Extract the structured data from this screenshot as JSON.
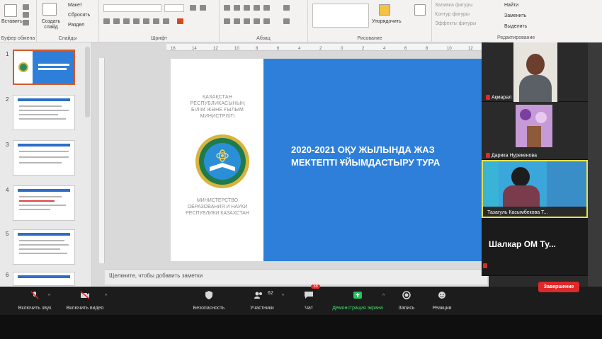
{
  "ribbon": {
    "groups": [
      "Буфер обмена",
      "Слайды",
      "Шрифт",
      "Абзац",
      "Рисование",
      "Редактирование"
    ],
    "clipboard_paste": "Вставить",
    "new_slide": "Создать слайд",
    "layout": "Макет",
    "reset": "Сбросить",
    "section": "Раздел",
    "arrange": "Упорядочить",
    "quick_styles": "Экспресс-стили",
    "shape_fill": "Заливка фигуры",
    "shape_outline": "Контур фигуры",
    "shape_effects": "Эффекты фигуры",
    "find": "Найти",
    "replace": "Заменить",
    "select": "Выделить"
  },
  "ruler": {
    "ticks": [
      "16",
      "14",
      "12",
      "10",
      "8",
      "6",
      "4",
      "2",
      "0",
      "2",
      "4",
      "6",
      "8",
      "10",
      "12"
    ]
  },
  "slides_panel": {
    "numbers": [
      "1",
      "2",
      "3",
      "4",
      "5",
      "6"
    ]
  },
  "slide": {
    "ministry_kz": [
      "ҚАЗАҚСТАН",
      "РЕСПУБЛИКАСЫНЫҢ",
      "БІЛІМ ЖӘНЕ ҒЫЛЫМ",
      "МИНИСТРЛІГІ"
    ],
    "ministry_ru": [
      "МИНИСТЕРСТВО",
      "ОБРАЗОВАНИЯ И НАУКИ",
      "РЕСПУБЛИКИ КАЗАХСТАН"
    ],
    "title_line1": "2020-2021 ОҚУ ЖЫЛЫНДА ЖАЗ",
    "title_line2": "МЕКТЕПТІ ҰЙЫМДАСТЫРУ ТУРА"
  },
  "notes": "Щелкните, чтобы добавить заметки",
  "participants": [
    {
      "name": "Ақмарал"
    },
    {
      "name": "Дарика Нурекенова"
    },
    {
      "name": "Тазагуль Касымбекова Т..."
    },
    {
      "name": "Шалкар ОМ Ту..."
    }
  ],
  "toolbar": {
    "mute": "Включить звук",
    "video": "Включить видео",
    "security": "Безопасность",
    "participants": "Участники",
    "participants_count": "62",
    "chat": "Чат",
    "chat_badge": "38",
    "share": "Демонстрация экрана",
    "record": "Запись",
    "reactions": "Реакции",
    "end": "Завершение"
  },
  "colors": {
    "slide_blue": "#2e7fd9",
    "end_red": "#e02828",
    "share_green": "#22c55e"
  }
}
